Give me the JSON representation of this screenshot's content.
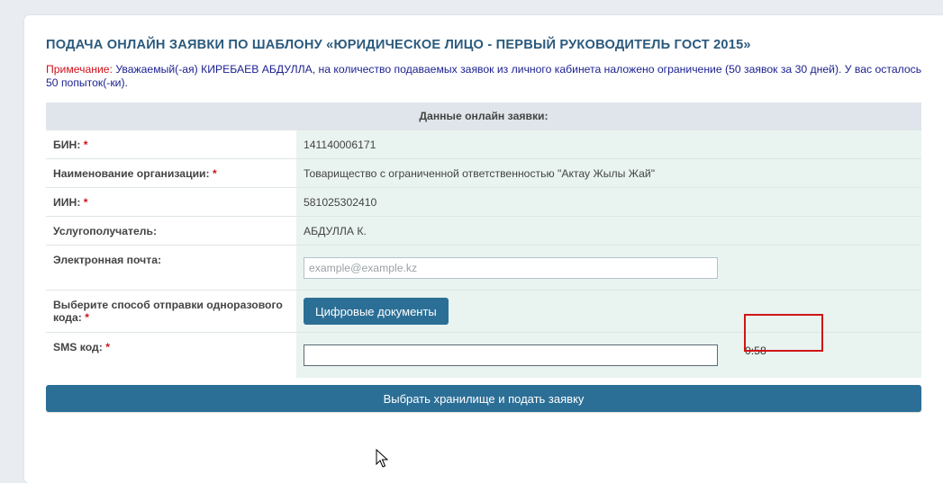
{
  "title": "ПОДАЧА ОНЛАЙН ЗАЯВКИ ПО ШАБЛОНУ «ЮРИДИЧЕСКОЕ ЛИЦО - ПЕРВЫЙ РУКОВОДИТЕЛЬ ГОСТ 2015»",
  "note": {
    "label": "Примечание:",
    "text": " Уважаемый(-ая) КИРЕБАЕВ АБДУЛЛА, на количество подаваемых заявок из личного кабинета наложено ограничение (50 заявок за 30 дней). У вас осталось 50 попыток(-ки)."
  },
  "form": {
    "header": "Данные онлайн заявки:",
    "required_mark": "*",
    "bin": {
      "label": "БИН:",
      "value": "141140006171"
    },
    "org": {
      "label": "Наименование организации:",
      "value": "Товарищество с ограниченной ответственностью \"Актау Жылы Жай\""
    },
    "iin": {
      "label": "ИИН:",
      "value": "581025302410"
    },
    "recipient": {
      "label": "Услугополучатель:",
      "value": "АБДУЛЛА К."
    },
    "email": {
      "label": "Электронная почта:",
      "value": "",
      "placeholder": "example@example.kz"
    },
    "method": {
      "label": "Выберите способ отправки одноразового кода:",
      "button": "Цифровые документы"
    },
    "sms": {
      "label": "SMS код:",
      "value": "",
      "timer": "0:58"
    }
  },
  "submit_label": "Выбрать хранилище и подать заявку",
  "colors": {
    "primary": "#2c6f96",
    "title": "#2b5a7d",
    "required": "#d0101a",
    "highlight": "#d01515"
  }
}
